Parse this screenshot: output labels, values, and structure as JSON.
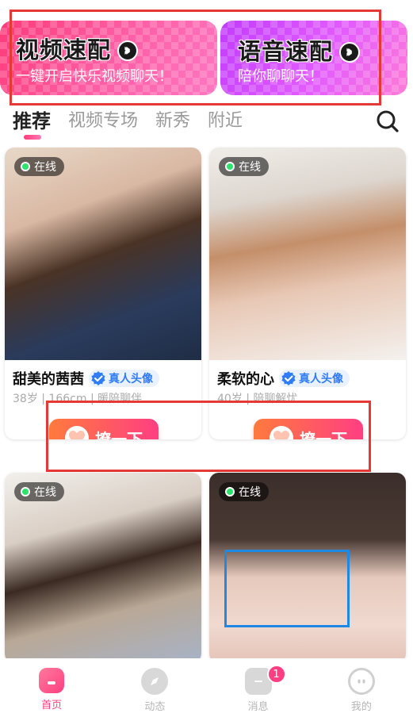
{
  "banners": {
    "video": {
      "title": "视频速配",
      "subtitle": "一键开启快乐视频聊天！"
    },
    "voice": {
      "title": "语音速配",
      "subtitle": "陪你聊聊天！"
    }
  },
  "tabs": [
    "推荐",
    "视频专场",
    "新秀",
    "附近"
  ],
  "cards": [
    {
      "status": "在线",
      "name": "甜美的茜茜",
      "verify": "真人头像",
      "meta": "38岁 | 166cm | 暖陪聊伴",
      "action": "撩一下"
    },
    {
      "status": "在线",
      "name": "柔软的心",
      "verify": "真人头像",
      "meta": "40岁 | 陪聊解忧",
      "action": "撩一下"
    },
    {
      "status": "在线"
    },
    {
      "status": "在线"
    }
  ],
  "nav": {
    "items": [
      {
        "label": "首页"
      },
      {
        "label": "动态"
      },
      {
        "label": "消息",
        "badge": "1"
      },
      {
        "label": "我的"
      }
    ]
  },
  "colors": {
    "accent": "#ff3f82",
    "online": "#2ee36b",
    "verify": "#2f7cf6"
  }
}
